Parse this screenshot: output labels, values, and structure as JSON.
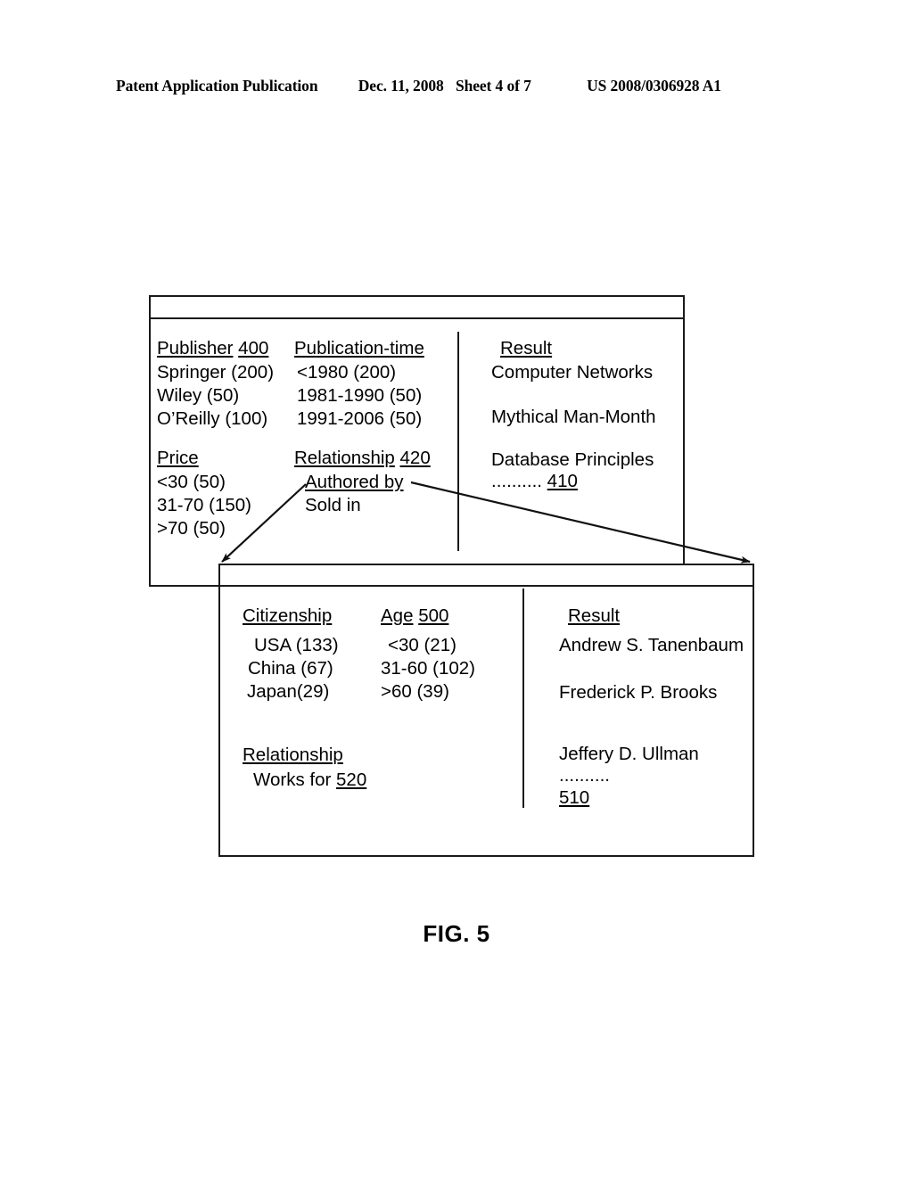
{
  "header": {
    "publication": "Patent Application Publication",
    "date": "Dec. 11, 2008",
    "sheet": "Sheet 4 of 7",
    "number": "US 2008/0306928 A1"
  },
  "figure": {
    "caption": "FIG. 5"
  },
  "upper_window": {
    "ref": "400",
    "facets": [
      {
        "title": "Publisher",
        "ref": "400",
        "values": [
          "Springer (200)",
          "Wiley (50)",
          "O’Reilly (100)"
        ]
      },
      {
        "title": "Publication-time",
        "ref": "",
        "values": [
          "<1980 (200)",
          "1981-1990 (50)",
          "1991-2006 (50)"
        ]
      },
      {
        "title": "Price",
        "ref": "",
        "values": [
          "<30 (50)",
          "31-70 (150)",
          ">70 (50)"
        ]
      },
      {
        "title": "Relationship",
        "ref": "420",
        "values": [
          "Authored by",
          "Sold in"
        ]
      }
    ],
    "result": {
      "title": "Result",
      "items": [
        "Computer Networks",
        "Mythical Man-Month",
        "Database Principles"
      ],
      "ellipsis": "..........",
      "ref": "410"
    }
  },
  "lower_window": {
    "ref": "500",
    "facets": [
      {
        "title": "Citizenship",
        "ref": "",
        "values": [
          "USA (133)",
          "China (67)",
          "Japan(29)"
        ]
      },
      {
        "title": "Age",
        "ref": "500",
        "values": [
          "<30 (21)",
          "31-60 (102)",
          ">60 (39)"
        ]
      },
      {
        "title": "Relationship",
        "ref": "520",
        "values": [
          "Works for"
        ]
      }
    ],
    "result": {
      "title": "Result",
      "items": [
        "Andrew S. Tanenbaum",
        "Frederick P. Brooks",
        "Jeffery D. Ullman"
      ],
      "ellipsis": "..........",
      "ref": "510"
    }
  }
}
